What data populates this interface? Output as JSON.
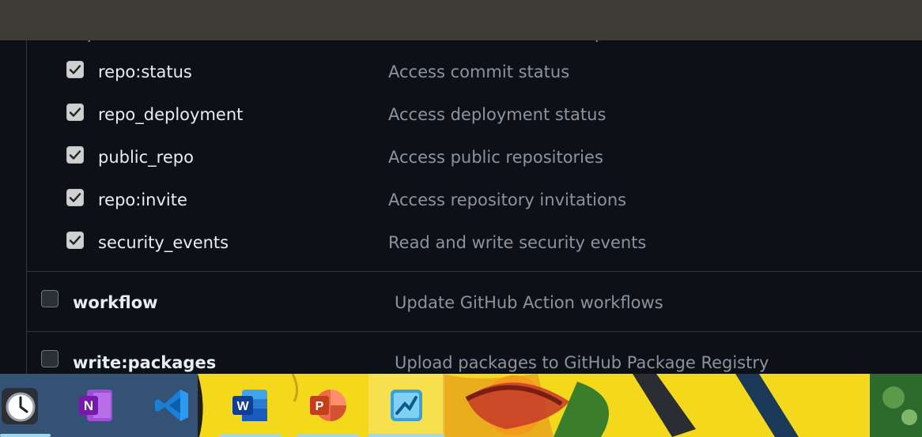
{
  "header": {
    "peek_left": "j",
    "peek_right": "ʃ"
  },
  "sub_scopes": [
    {
      "name": "repo:status",
      "description": "Access commit status",
      "checked": true
    },
    {
      "name": "repo_deployment",
      "description": "Access deployment status",
      "checked": true
    },
    {
      "name": "public_repo",
      "description": "Access public repositories",
      "checked": true
    },
    {
      "name": "repo:invite",
      "description": "Access repository invitations",
      "checked": true
    },
    {
      "name": "security_events",
      "description": "Read and write security events",
      "checked": true
    }
  ],
  "scopes": [
    {
      "name": "workflow",
      "description": "Update GitHub Action workflows",
      "checked": false
    },
    {
      "name": "write:packages",
      "description": "Upload packages to GitHub Package Registry",
      "checked": false
    }
  ],
  "taskbar": {
    "apps": [
      {
        "name": "Clock",
        "icon": "clock-icon"
      },
      {
        "name": "OneNote",
        "icon": "onenote-icon",
        "letter": "N"
      },
      {
        "name": "Visual Studio Code",
        "icon": "vscode-icon"
      },
      {
        "name": "Word",
        "icon": "word-icon",
        "letter": "W"
      },
      {
        "name": "PowerPoint",
        "icon": "powerpoint-icon",
        "letter": "P"
      },
      {
        "name": "Remote Desktop",
        "icon": "remote-desktop-icon"
      }
    ]
  },
  "colors": {
    "background": "#0d1117",
    "top_bar": "#3f3b37",
    "text_primary": "#e6edf3",
    "text_secondary": "#8b949e",
    "border": "#30363d",
    "taskbar_wallpaper": "#f4d81c",
    "taskbar_indicator": "#9fd8ee"
  }
}
